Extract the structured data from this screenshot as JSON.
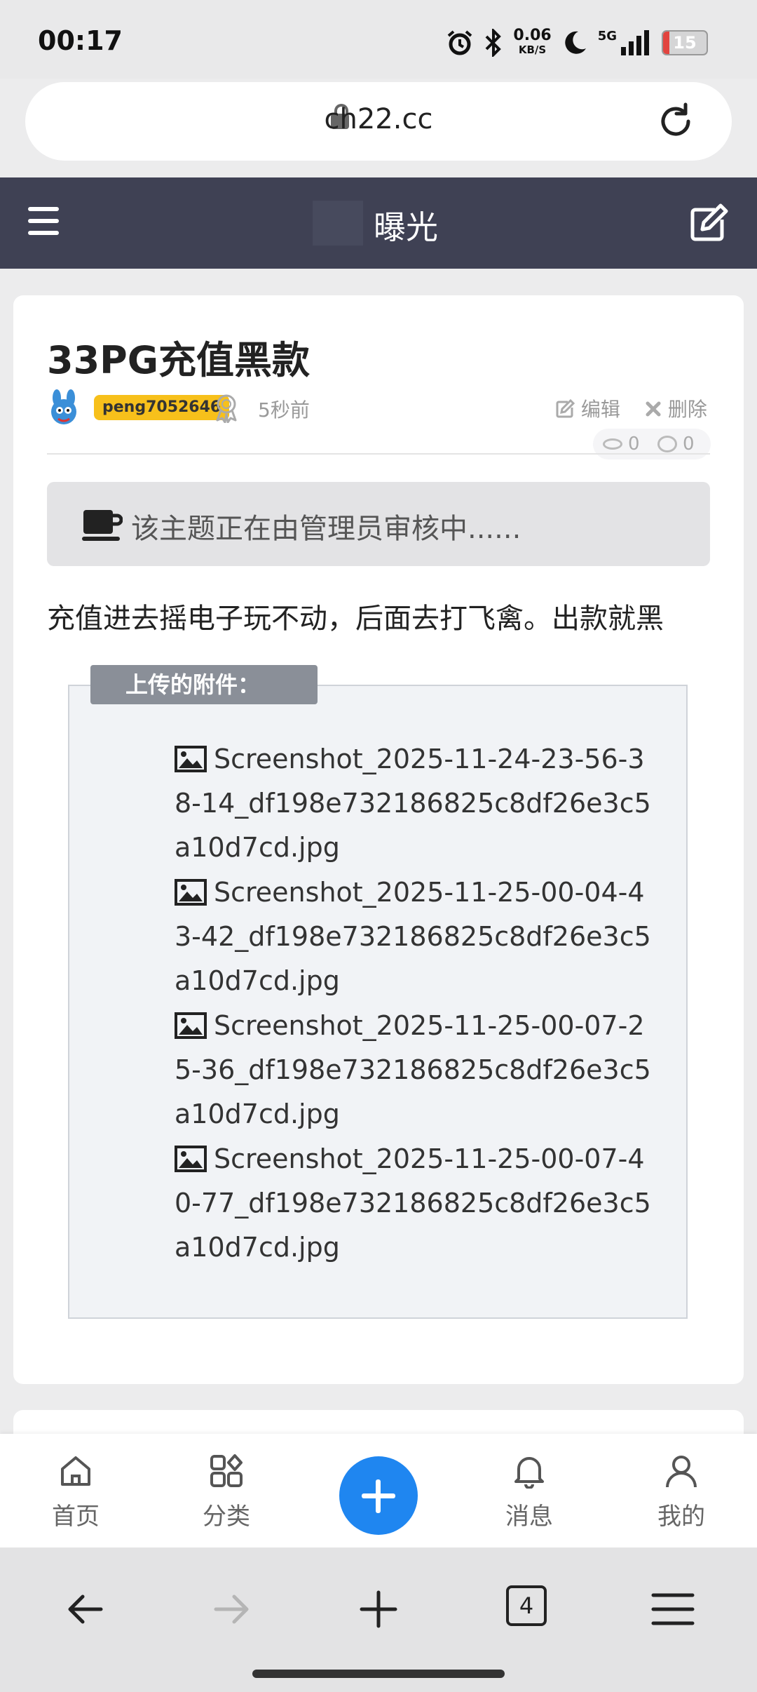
{
  "status_bar": {
    "time": "00:17",
    "net_speed": "0.06",
    "net_speed_unit": "KB/S",
    "network": "5G",
    "battery": "15",
    "battery_level": 0.15,
    "icons": [
      "alarm-icon",
      "bluetooth-icon",
      "moon-icon",
      "signal-icon",
      "battery-icon"
    ]
  },
  "browser": {
    "url": "ch22.cc",
    "tab_count": "4"
  },
  "header": {
    "title": "曝光"
  },
  "post": {
    "title": "33PG充值黑款",
    "author": "peng7052646",
    "time": "5秒前",
    "edit_label": "编辑",
    "delete_label": "删除",
    "views": "0",
    "comments": "0",
    "review_notice": "该主题正在由管理员审核中......",
    "body": "充值进去摇电子玩不动，后面去打飞禽。出款就黑"
  },
  "attachments": {
    "legend": "上传的附件：",
    "files": [
      "Screenshot_2025-11-24-23-56-38-14_df198e732186825c8df26e3c5a10d7cd.jpg",
      "Screenshot_2025-11-25-00-04-43-42_df198e732186825c8df26e3c5a10d7cd.jpg",
      "Screenshot_2025-11-25-00-07-25-36_df198e732186825c8df26e3c5a10d7cd.jpg",
      "Screenshot_2025-11-25-00-07-40-77_df198e732186825c8df26e3c5a10d7cd.jpg"
    ]
  },
  "bottom_nav": {
    "items": [
      {
        "label": "首页",
        "icon": "home-icon"
      },
      {
        "label": "分类",
        "icon": "grid-icon"
      },
      {
        "label": "消息",
        "icon": "bell-icon"
      },
      {
        "label": "我的",
        "icon": "user-icon"
      }
    ]
  },
  "colors": {
    "header_bg": "#3f4154",
    "accent": "#1f86f0",
    "badge": "#f7c01b"
  }
}
